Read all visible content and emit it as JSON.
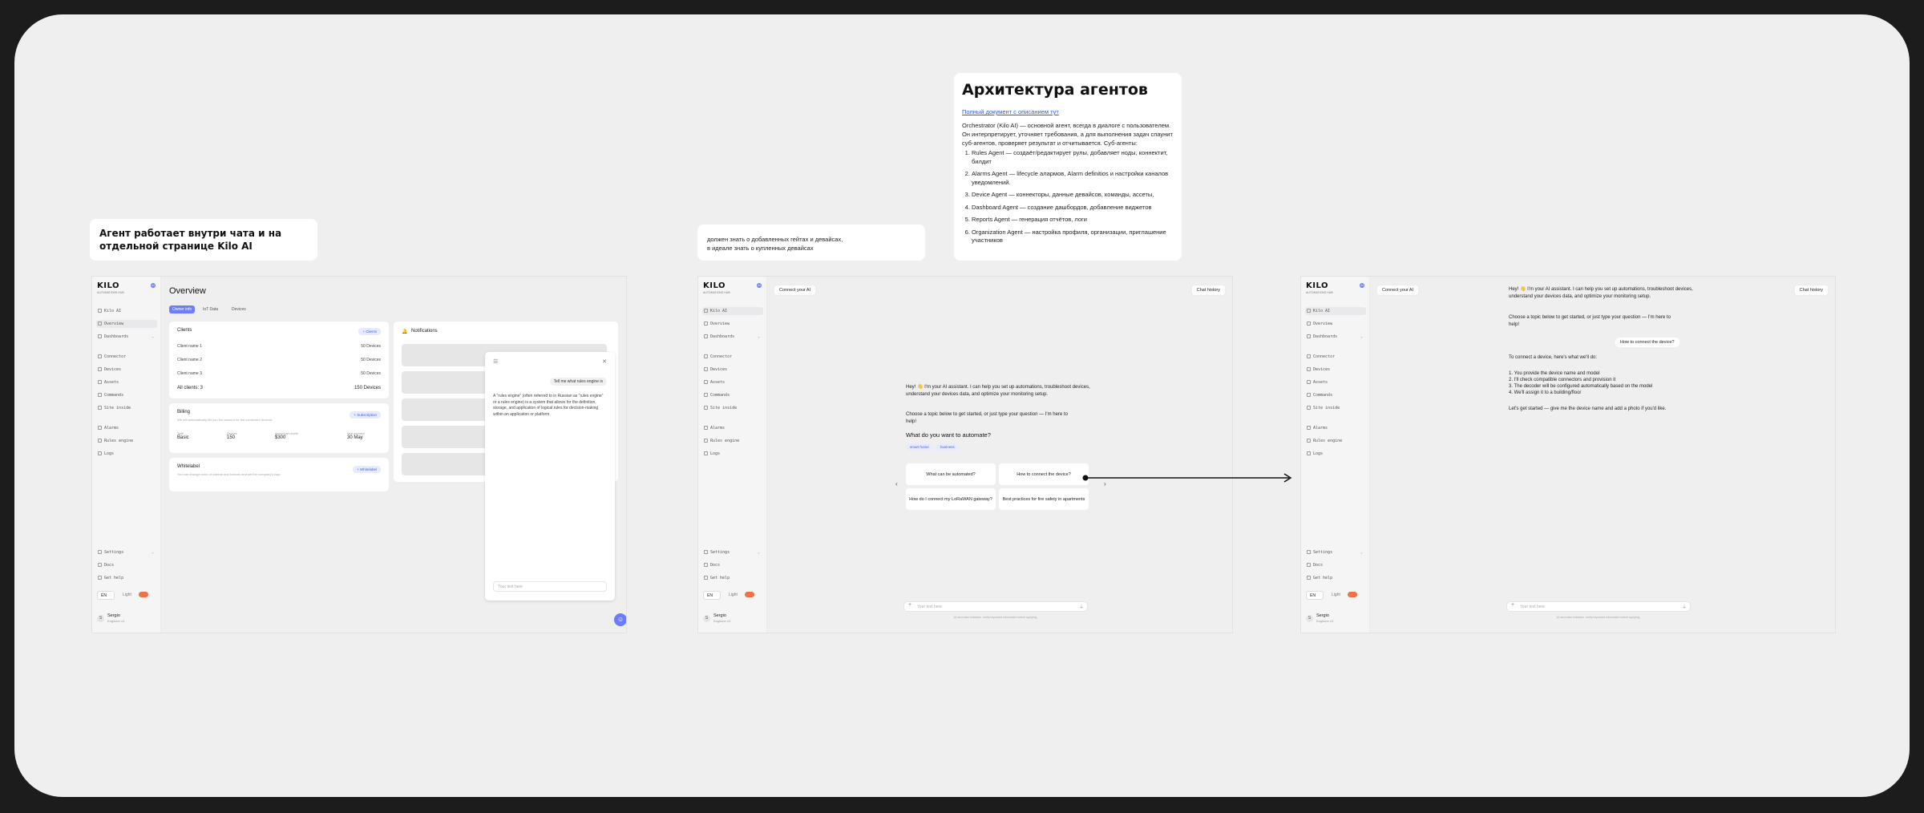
{
  "note_left": {
    "text": "Агент работает внутри чата и на отдельной странице Kilo AI"
  },
  "note_middle": {
    "line1": "должен знать о добавленных гейтах и девайсах,",
    "line2": "в идеале знать о купленных девайсах"
  },
  "architecture": {
    "title": "Архитектура агентов",
    "link": "Полный документ с описанием тут",
    "intro": "Orchestrator (Kilo AI) — основной агент, всегда в диалоге с пользователем. Он интерпретирует, уточняет требования, а для выполнения задач спаунит суб-агентов, проверяет результат и отчитывается. Суб-агенты:",
    "agents": [
      "Rules Agent — создаёт/редактирует рулы, добавляет ноды, коннектит, билдит",
      "Alarms Agent — lifecycle алармов, Alarm definitios и настройки каналов уведомлений.",
      "Device Agent — коннекторы, данные девайсов, команды, ассеты,",
      "Dashboard Agent — создание дашбордов, добавление виджетов",
      "Reports Agent — генерация отчётов, логи",
      "Organization Agent — настройка профиля, организации, приглашение участников"
    ]
  },
  "sidebar": {
    "logo": "KILO",
    "logo_sub": "AUTOMATIONS HUB",
    "badge": "AI",
    "items": [
      {
        "label": "Kilo AI"
      },
      {
        "label": "Overview"
      },
      {
        "label": "Dashboards"
      },
      {
        "label": "Connector"
      },
      {
        "label": "Devices"
      },
      {
        "label": "Assets"
      },
      {
        "label": "Commands"
      },
      {
        "label": "Site inside"
      },
      {
        "label": "Alarms"
      },
      {
        "label": "Rules engine"
      },
      {
        "label": "Logs"
      }
    ],
    "bottom_items": [
      {
        "label": "Settings"
      },
      {
        "label": "Docs"
      },
      {
        "label": "Get help"
      }
    ],
    "lang": "EN",
    "theme": "Light",
    "user_name": "Sergio",
    "user_role": "Engineer x3",
    "avatar": "S"
  },
  "frame1": {
    "title": "Overview",
    "tabs": [
      "Owner info",
      "IoT Data",
      "Devices"
    ],
    "clients": {
      "title": "Clients",
      "button": "+ Clients",
      "rows": [
        {
          "name": "Client name 1",
          "value": "50 Devices"
        },
        {
          "name": "Client name 2",
          "value": "50 Devices"
        },
        {
          "name": "Client name 3",
          "value": "50 Devices"
        }
      ],
      "total_label": "All clients: 3",
      "total_value": "150 Devices"
    },
    "billing": {
      "title": "Billing",
      "desc": "We will automatically bill you the amount for the connected devices",
      "button": "+ Subscription",
      "cols": [
        {
          "label": "Tariff",
          "value": "Basic"
        },
        {
          "label": "Devices",
          "value": "150"
        },
        {
          "label": "Amount per month",
          "value": "$300"
        },
        {
          "label": "Next payment",
          "value": "30 May"
        }
      ]
    },
    "whitelabel": {
      "title": "Whitelabel",
      "desc": "You can change color of sidebar and buttons and set the company's logo",
      "button": "+ Whitelabel"
    },
    "notifications": {
      "title": "Notifications"
    },
    "chat": {
      "user_msg": "Tell me what rules engine is",
      "answer": "A \"rules engine\" (often referred to in Russian as \"rules engine\" or a rules engine) is a system that allows for the definition, storage, and application of logical rules for decision-making within an application or platform.",
      "placeholder": "Your text here"
    }
  },
  "frame2": {
    "connect": "Connect your AI",
    "history": "Chat history",
    "greeting": "Hey! 👋 I'm your AI assistant. I can help you set up automations, troubleshoot devices, understand your devices data, and optimize your monitoring setup.",
    "prompt": "Choose a topic below to get started, or just type your question — I'm here to help!",
    "question": "What do you want to automate?",
    "chips": [
      "smart home",
      "business"
    ],
    "options": [
      "What can be automated?",
      "How to connect the device?",
      "How do I connect my LoRaWAN gateway?",
      "Best practices for fire safety in apartments"
    ],
    "placeholder": "Your text here",
    "disclaimer": "AI can make mistakes. Verify important information before applying."
  },
  "frame3": {
    "connect": "Connect your AI",
    "history": "Chat history",
    "greeting": "Hey! 👋 I'm your AI assistant. I can help you set up automations, troubleshoot devices, understand your devices data, and optimize your monitoring setup.",
    "prompt": "Choose a topic below to get started, or just type your question — I'm here to help!",
    "user_msg": "How to connect the device?",
    "answer_intro": "To connect a device, here's what we'll do:",
    "steps": [
      "1. You provide the device name and model",
      "2. I'll check compatible connectors and provision it",
      "3. The decoder will be configured automatically based on the model",
      "4. We'll assign it to a building/floor"
    ],
    "outro": "Let's get started — give me the device name and add a photo if you'd like.",
    "placeholder": "Your text here",
    "disclaimer": "AI can make mistakes. Verify important information before applying."
  }
}
